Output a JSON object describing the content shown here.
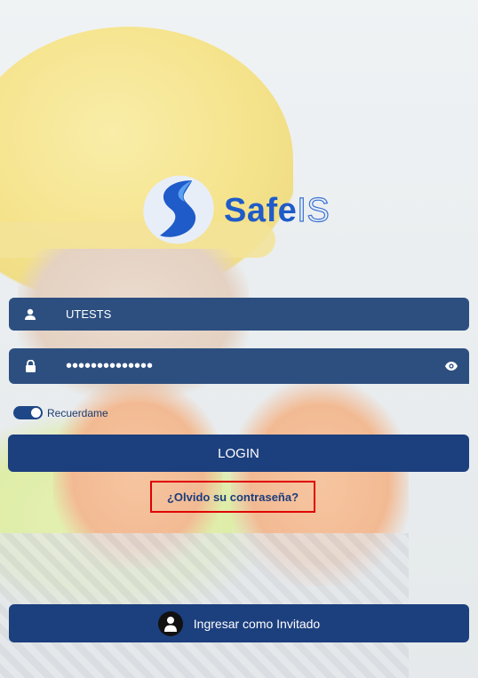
{
  "brand": {
    "name_part1": "Safe",
    "name_part2": "IS"
  },
  "login_form": {
    "username": {
      "value": "UTESTS",
      "icon": "user-icon"
    },
    "password": {
      "masked_value": "••••••••••••••",
      "icon": "lock-icon",
      "toggle_icon": "eye-icon"
    },
    "remember": {
      "label": "Recuerdame",
      "checked": true
    },
    "login_button": "LOGIN",
    "forgot_link": "¿Olvido su contraseña?",
    "guest_button": {
      "label": "Ingresar como Invitado",
      "icon": "person-icon"
    }
  },
  "colors": {
    "field_bg": "#2d4f80",
    "button_bg": "#1c3f7e",
    "brand_blue": "#1f5bc9",
    "highlight_border": "#e00000"
  }
}
